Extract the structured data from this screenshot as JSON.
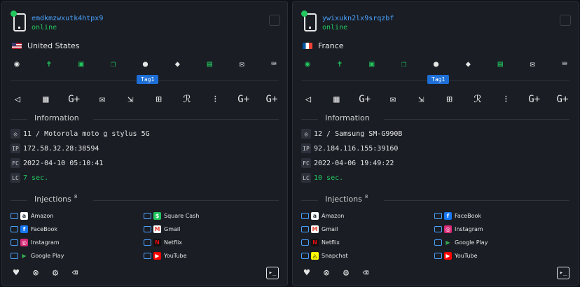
{
  "tag_label": "Tag1",
  "labels": {
    "information": "Information",
    "injections": "Injections"
  },
  "badges": {
    "ip": "IP",
    "fc": "FC",
    "lc": "LC"
  },
  "colors": {
    "online": "#22c55e",
    "accent": "#4aa3ff",
    "tag_bg": "#1d6fd6",
    "bg": "#1a1d24"
  },
  "toolbar_top": [
    "eye-icon",
    "person-icon",
    "contact-icon",
    "copy-icon",
    "bolt-icon",
    "shield-icon",
    "lock-icon",
    "mail-icon",
    "keyboard-icon"
  ],
  "toolbar_actions": [
    "megaphone-icon",
    "calendar-icon",
    "google-plus-icon",
    "envelope-icon",
    "forward-mail-icon",
    "grid-icon",
    "people-icon",
    "dial-icon",
    "google-plus-icon",
    "google-plus-icon"
  ],
  "bottom_actions": [
    "heart-icon",
    "close-circle-icon",
    "gear-icon",
    "trash-icon"
  ],
  "cards": [
    {
      "id": "emdkmzwxutk4htpx9",
      "status": "online",
      "country": "United States",
      "flag": "us",
      "device": "11 / Motorola moto g stylus 5G",
      "ip": "172.58.32.28:38594",
      "fc": "2022-04-10 05:10:41",
      "lc": "7 sec.",
      "injections_count": "8",
      "injections": [
        "Amazon",
        "Square Cash",
        "FaceBook",
        "Gmail",
        "Instagram",
        "Netflix",
        "Google Play",
        "YouTube"
      ]
    },
    {
      "id": "ywixukn2lx9srqzbf",
      "status": "online",
      "country": "France",
      "flag": "fr",
      "device": "12 / Samsung SM-G990B",
      "ip": "92.184.116.155:39160",
      "fc": "2022-04-06 19:49:22",
      "lc": "10 sec.",
      "injections_count": "8",
      "injections": [
        "Amazon",
        "FaceBook",
        "Gmail",
        "Instagram",
        "Netflix",
        "Google Play",
        "Snapchat",
        "YouTube"
      ]
    }
  ]
}
